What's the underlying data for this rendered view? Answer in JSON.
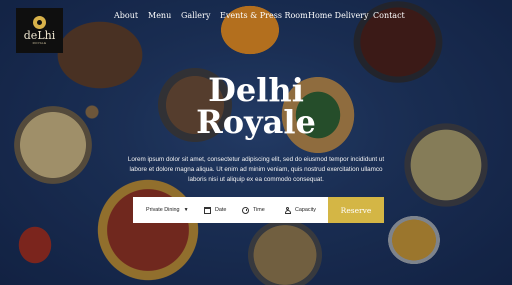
{
  "brand": {
    "logo_text": "deLhi",
    "logo_subtext": "ROYALE",
    "accent_color": "#d4b645"
  },
  "nav": {
    "items": [
      {
        "label": "About"
      },
      {
        "label": "Menu"
      },
      {
        "label": "Gallery"
      },
      {
        "label": "Events & Press Room"
      },
      {
        "label": "Home Delivery"
      },
      {
        "label": "Contact"
      }
    ]
  },
  "hero": {
    "title_line1": "Delhi",
    "title_line2": "Royale",
    "description": "Lorem ipsum dolor sit amet, consectetur adipiscing elit, sed do eiusmod tempor incididunt ut labore et dolore magna aliqua. Ut enim ad minim veniam, quis nostrud exercitation ullamco laboris nisi ut aliquip ex ea commodo consequat."
  },
  "reservation": {
    "type_select": "Private Dining",
    "date_label": "Date",
    "time_label": "Time",
    "capacity_label": "Capacity",
    "reserve_label": "Reserve",
    "icons": [
      "chevron-down-icon",
      "calendar-icon",
      "clock-icon",
      "user-icon"
    ]
  }
}
